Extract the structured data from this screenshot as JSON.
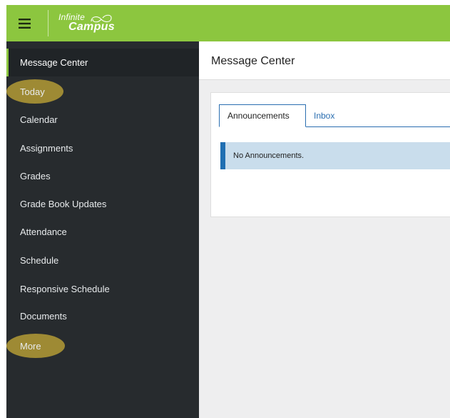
{
  "app": {
    "logo_line1": "Infinite",
    "logo_line2": "Campus",
    "brand_color": "#8cc63f"
  },
  "icons": {
    "menu": "hamburger-menu-icon",
    "logo": "infinity-logo-icon"
  },
  "sidebar": {
    "items": [
      {
        "label": "Message Center",
        "active": true
      },
      {
        "label": "Today",
        "highlighted": true
      },
      {
        "label": "Calendar"
      },
      {
        "label": "Assignments"
      },
      {
        "label": "Grades"
      },
      {
        "label": "Grade Book Updates"
      },
      {
        "label": "Attendance"
      },
      {
        "label": "Schedule"
      },
      {
        "label": "Responsive Schedule"
      },
      {
        "label": "Documents"
      },
      {
        "label": "More",
        "highlighted": true
      }
    ]
  },
  "main": {
    "title": "Message Center",
    "tabs": [
      {
        "label": "Announcements",
        "active": true
      },
      {
        "label": "Inbox",
        "active": false
      }
    ],
    "alert_text": "No Announcements."
  }
}
